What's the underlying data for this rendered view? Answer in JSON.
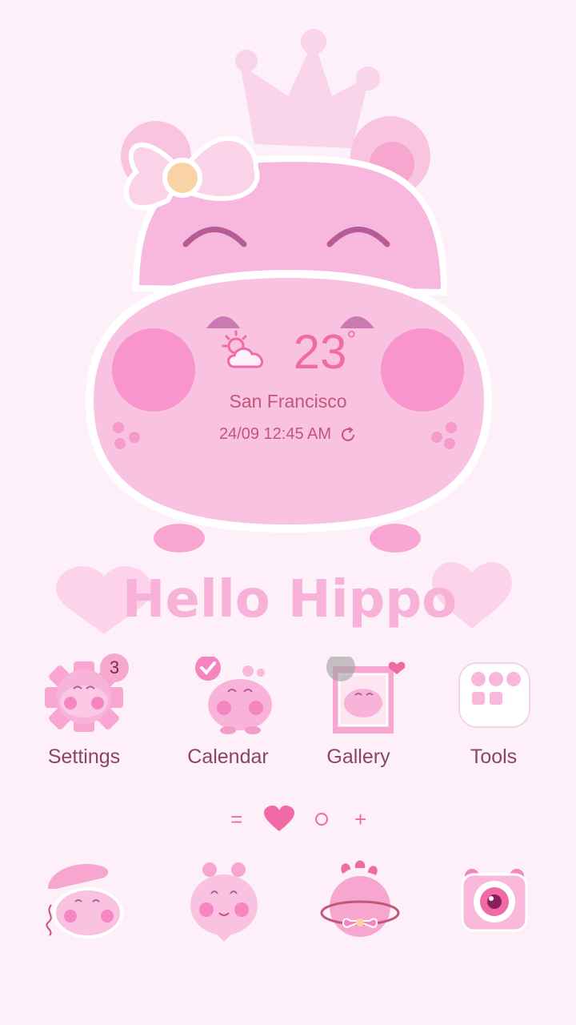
{
  "weather": {
    "temperature": "23",
    "degree": "°",
    "city": "San Francisco",
    "datetime": "24/09 12:45 AM",
    "icon": "partly-cloudy-icon"
  },
  "theme_title": "Hello Hippo",
  "apps": [
    {
      "label": "Settings",
      "icon": "settings-hippo-icon",
      "badge": "3"
    },
    {
      "label": "Calendar",
      "icon": "calendar-hippo-icon"
    },
    {
      "label": "Gallery",
      "icon": "gallery-hippo-icon"
    },
    {
      "label": "Tools",
      "icon": "tools-folder-icon"
    }
  ],
  "page_indicator": {
    "items": [
      "=",
      "heart",
      "circle",
      "+"
    ],
    "active": "heart"
  },
  "dock": [
    {
      "icon": "phone-hippo-icon"
    },
    {
      "icon": "contacts-hippo-icon"
    },
    {
      "icon": "browser-planet-icon"
    },
    {
      "icon": "camera-hippo-icon"
    }
  ],
  "colors": {
    "background": "#fdf0f8",
    "accent": "#f06aa6",
    "text": "#8b4560",
    "hippo": "#f9b8da"
  }
}
